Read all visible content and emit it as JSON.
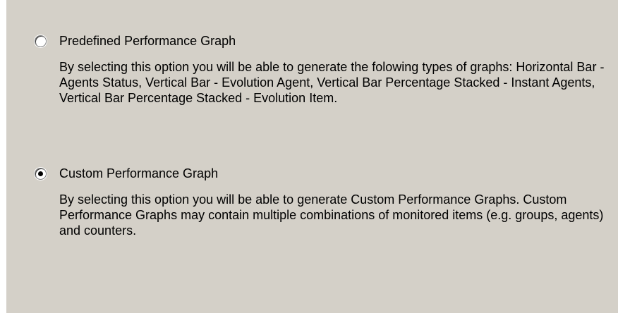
{
  "options": [
    {
      "label": "Predefined Performance Graph",
      "selected": false,
      "description": "By selecting this option you will be able to generate the folowing types of graphs: Horizontal Bar - Agents Status,  Vertical Bar - Evolution Agent,  Vertical Bar Percentage Stacked - Instant Agents,  Vertical Bar Percentage Stacked - Evolution Item."
    },
    {
      "label": "Custom Performance Graph",
      "selected": true,
      "description": "By selecting this option you will be able to generate Custom Performance Graphs. Custom Performance Graphs may contain multiple combinations of monitored items (e.g. groups, agents) and counters."
    }
  ],
  "colors": {
    "panel_background": "#d4d0c8",
    "text": "#000000"
  }
}
